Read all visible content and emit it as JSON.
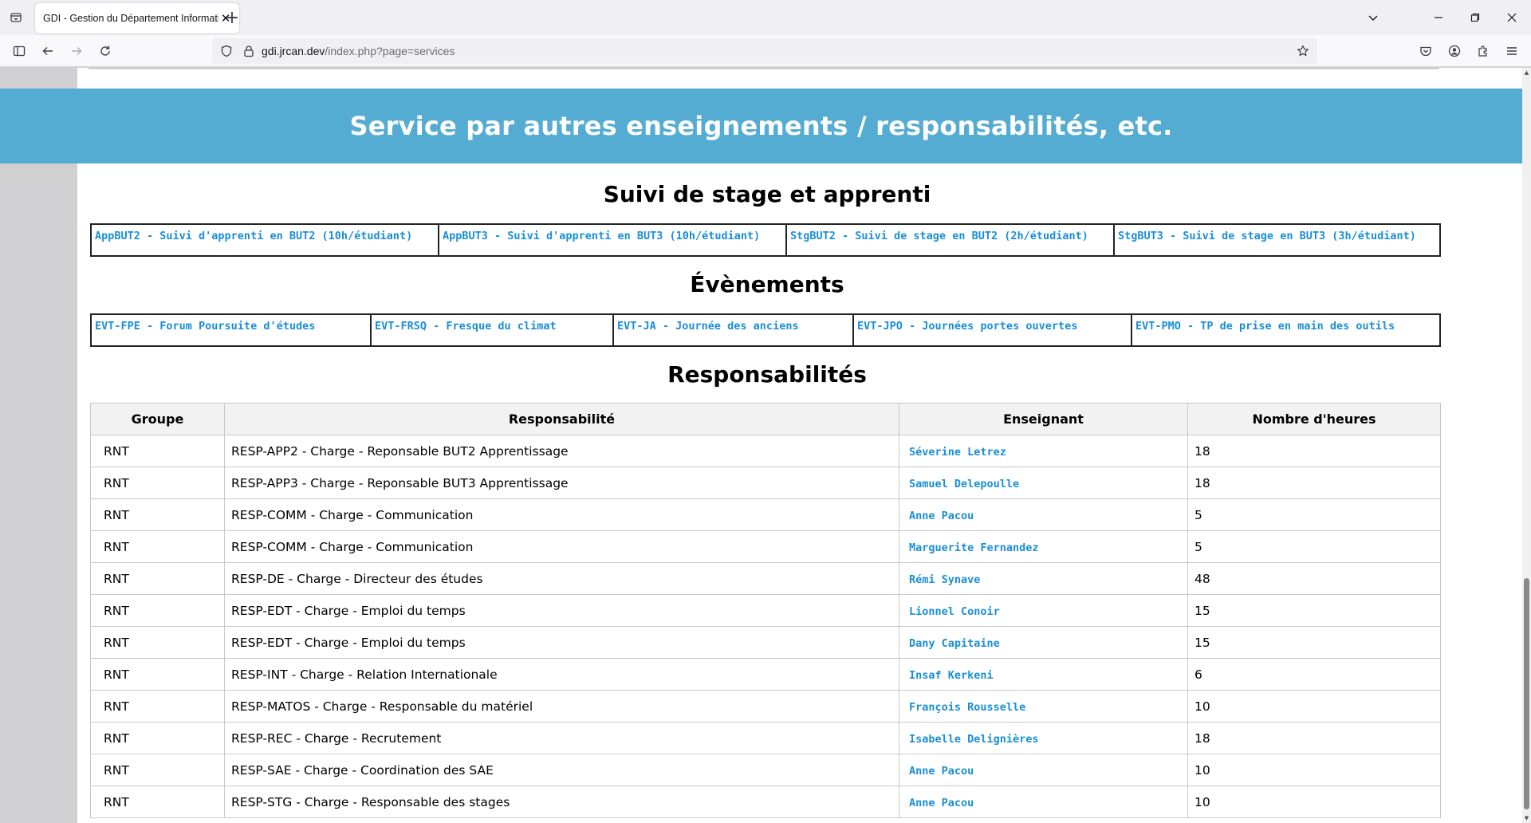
{
  "browser": {
    "tab_title": "GDI - Gestion du Département Informatique",
    "tab_close": "✕",
    "new_tab": "+",
    "url_host": "gdi.jrcan.dev",
    "url_prefix": "",
    "url_path": "/index.php?page=services",
    "icons": [
      "tab-list-icon",
      "close-icon",
      "plus-icon",
      "chevron-down-icon",
      "minimize-icon",
      "restore-icon",
      "close-window-icon",
      "sidebar-icon",
      "back-icon",
      "forward-icon",
      "reload-icon",
      "shield-icon",
      "lock-icon",
      "star-icon",
      "pocket-icon",
      "account-icon",
      "extensions-icon",
      "menu-icon"
    ]
  },
  "page": {
    "banner_title": "Service par autres enseignements / responsabilités, etc.",
    "sections": {
      "stage": {
        "title": "Suivi de stage et apprenti",
        "links": [
          "AppBUT2 - Suivi d'apprenti en BUT2 (10h/étudiant)",
          "AppBUT3 - Suivi d'apprenti en BUT3 (10h/étudiant)",
          "StgBUT2 - Suivi de stage en BUT2 (2h/étudiant)",
          "StgBUT3 - Suivi de stage en BUT3 (3h/étudiant)"
        ]
      },
      "events": {
        "title": "Évènements",
        "links": [
          "EVT-FPE - Forum Poursuite d'études",
          "EVT-FRSQ - Fresque du climat",
          "EVT-JA - Journée des anciens",
          "EVT-JPO - Journées portes ouvertes",
          "EVT-PMO - TP de prise en main des outils"
        ]
      },
      "resp": {
        "title": "Responsabilités",
        "headers": [
          "Groupe",
          "Responsabilité",
          "Enseignant",
          "Nombre d'heures"
        ],
        "rows": [
          [
            "RNT",
            "RESP-APP2 - Charge - Reponsable BUT2 Apprentissage",
            "Séverine Letrez",
            "18"
          ],
          [
            "RNT",
            "RESP-APP3 - Charge - Reponsable BUT3 Apprentissage",
            "Samuel Delepoulle",
            "18"
          ],
          [
            "RNT",
            "RESP-COMM - Charge - Communication",
            "Anne Pacou",
            "5"
          ],
          [
            "RNT",
            "RESP-COMM - Charge - Communication",
            "Marguerite Fernandez",
            "5"
          ],
          [
            "RNT",
            "RESP-DE - Charge - Directeur des études",
            "Rémi Synave",
            "48"
          ],
          [
            "RNT",
            "RESP-EDT - Charge - Emploi du temps",
            "Lionnel Conoir",
            "15"
          ],
          [
            "RNT",
            "RESP-EDT - Charge - Emploi du temps",
            "Dany Capitaine",
            "15"
          ],
          [
            "RNT",
            "RESP-INT - Charge - Relation Internationale",
            "Insaf Kerkeni",
            "6"
          ],
          [
            "RNT",
            "RESP-MATOS - Charge - Responsable du matériel",
            "François Rousselle",
            "10"
          ],
          [
            "RNT",
            "RESP-REC - Charge - Recrutement",
            "Isabelle Delignières",
            "18"
          ],
          [
            "RNT",
            "RESP-SAE - Charge - Coordination des SAE",
            "Anne Pacou",
            "10"
          ],
          [
            "RNT",
            "RESP-STG - Charge - Responsable des stages",
            "Anne Pacou",
            "10"
          ]
        ]
      }
    }
  },
  "colors": {
    "banner": "#54acd2",
    "link": "#1a8ed8",
    "header_bg": "#f2f2f2"
  }
}
